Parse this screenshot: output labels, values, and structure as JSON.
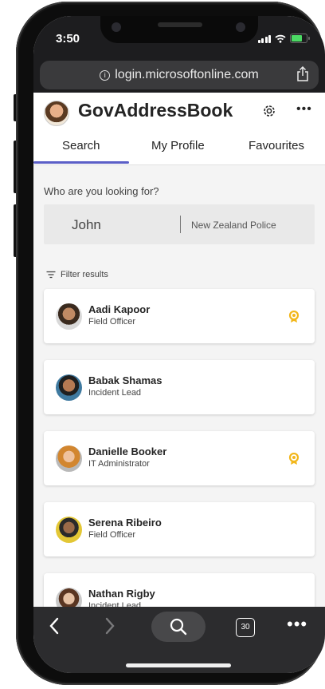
{
  "status_bar": {
    "time": "3:50"
  },
  "browser": {
    "url": "login.microsoftonline.com"
  },
  "app": {
    "title": "GovAddressBook",
    "tabs": [
      {
        "label": "Search",
        "active": true
      },
      {
        "label": "My Profile",
        "active": false
      },
      {
        "label": "Favourites",
        "active": false
      }
    ]
  },
  "search": {
    "question": "Who are you looking for?",
    "query": "John",
    "organization": "New Zealand Police"
  },
  "filter": {
    "label": "Filter results"
  },
  "results": [
    {
      "name": "Aadi Kapoor",
      "role": "Field Officer",
      "badge": true
    },
    {
      "name": "Babak Shamas",
      "role": "Incident Lead",
      "badge": false
    },
    {
      "name": "Danielle Booker",
      "role": "IT Administrator",
      "badge": true
    },
    {
      "name": "Serena Ribeiro",
      "role": "Field Officer",
      "badge": false
    },
    {
      "name": "Nathan Rigby",
      "role": "Incident Lead",
      "badge": false
    }
  ],
  "toolbar": {
    "tab_count": "30"
  },
  "colors": {
    "accent": "#5b5fc7",
    "badge": "#f2b71b",
    "toolbar_bg": "#2c2c2e"
  },
  "icons": [
    "info-icon",
    "share-icon",
    "settings-gear-icon",
    "more-icon",
    "filter-icon",
    "award-badge-icon",
    "back-chevron-icon",
    "forward-chevron-icon",
    "search-icon",
    "tabs-icon"
  ]
}
